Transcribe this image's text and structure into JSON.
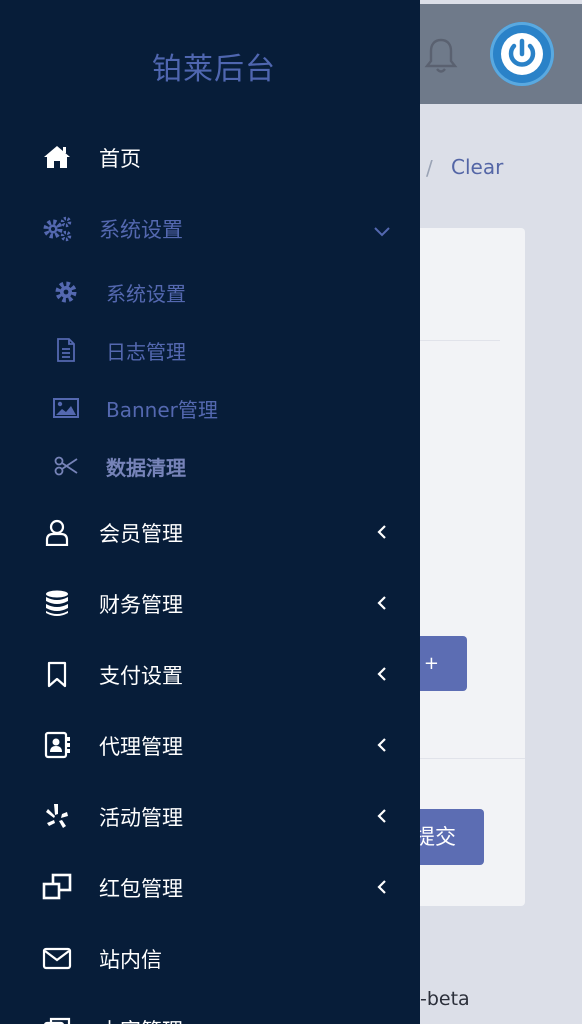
{
  "header": {
    "bell_icon": "bell-icon",
    "power_icon": "power-icon"
  },
  "breadcrumb": {
    "separator": "/",
    "current": "Clear"
  },
  "content": {
    "add_button_label": "+",
    "submit_button_label": "提交",
    "footer_version_fragment": "-beta"
  },
  "sidebar": {
    "brand": "铂莱后台",
    "items": [
      {
        "label": "首页",
        "icon": "home-icon"
      },
      {
        "label": "系统设置",
        "icon": "cogs-icon",
        "expanded": true
      },
      {
        "label": "会员管理",
        "icon": "user-icon"
      },
      {
        "label": "财务管理",
        "icon": "database-icon"
      },
      {
        "label": "支付设置",
        "icon": "bookmark-icon"
      },
      {
        "label": "代理管理",
        "icon": "contact-book-icon"
      },
      {
        "label": "活动管理",
        "icon": "yelp-icon"
      },
      {
        "label": "红包管理",
        "icon": "clone-icon"
      },
      {
        "label": "站内信",
        "icon": "envelope-icon"
      },
      {
        "label": "内容管理",
        "icon": "copy-icon"
      }
    ],
    "subitems": [
      {
        "label": "系统设置",
        "icon": "gear-icon"
      },
      {
        "label": "日志管理",
        "icon": "file-text-icon"
      },
      {
        "label": "Banner管理",
        "icon": "image-icon"
      },
      {
        "label": "数据清理",
        "icon": "scissors-icon",
        "current": true
      }
    ]
  },
  "colors": {
    "sidebar_bg": "#071d39",
    "accent": "#5468b0",
    "button": "#5c6db3",
    "topbar": "#6f7a8a",
    "power_button": "#2a82c8"
  }
}
